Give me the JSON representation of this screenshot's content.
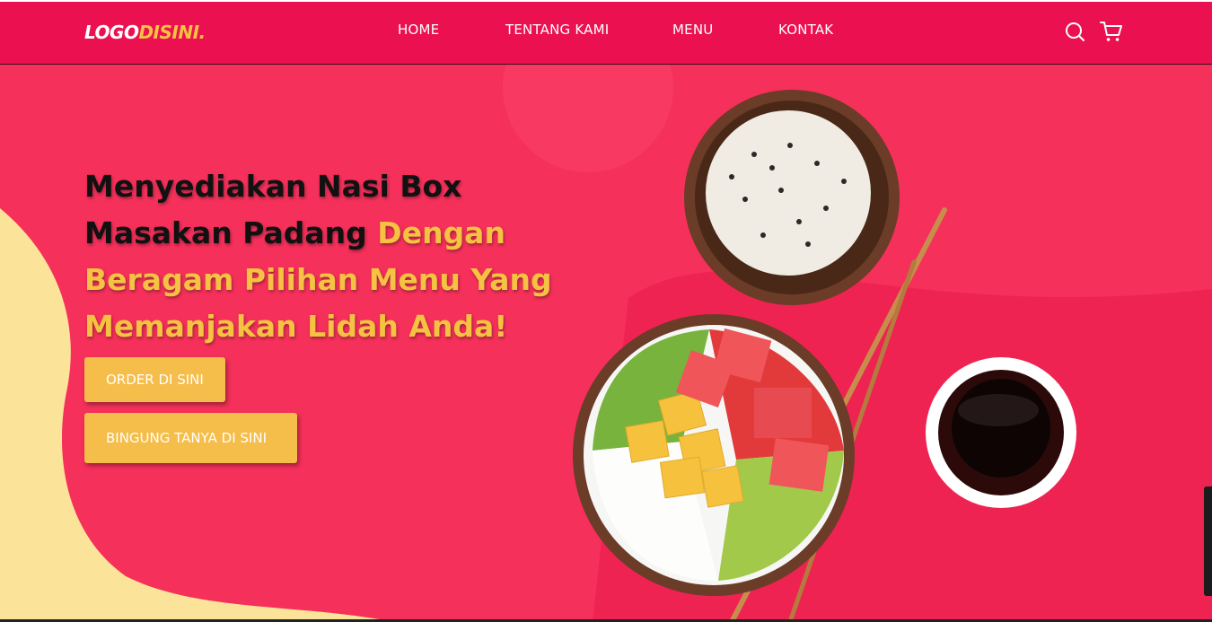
{
  "header": {
    "logo_main": "LOGO",
    "logo_accent": "DISINI",
    "logo_dot": ".",
    "nav": [
      "HOME",
      "TENTANG KAMI",
      "MENU",
      "KONTAK"
    ],
    "icons": [
      "search-icon",
      "cart-icon"
    ]
  },
  "hero": {
    "headline_dark": "Menyediakan Nasi Box Masakan Padang",
    "headline_highlight": "Dengan Beragam Pilihan Menu Yang Memanjakan Lidah Anda!",
    "btn_order": "ORDER DI SINI",
    "btn_ask": "BINGUNG TANYA DI SINI"
  },
  "colors": {
    "navbar": "#eb1150",
    "hero_bg": "#f5305a",
    "accent_yellow": "#f5c242",
    "button": "#f5bd4a",
    "blob": "#fbe49a"
  }
}
